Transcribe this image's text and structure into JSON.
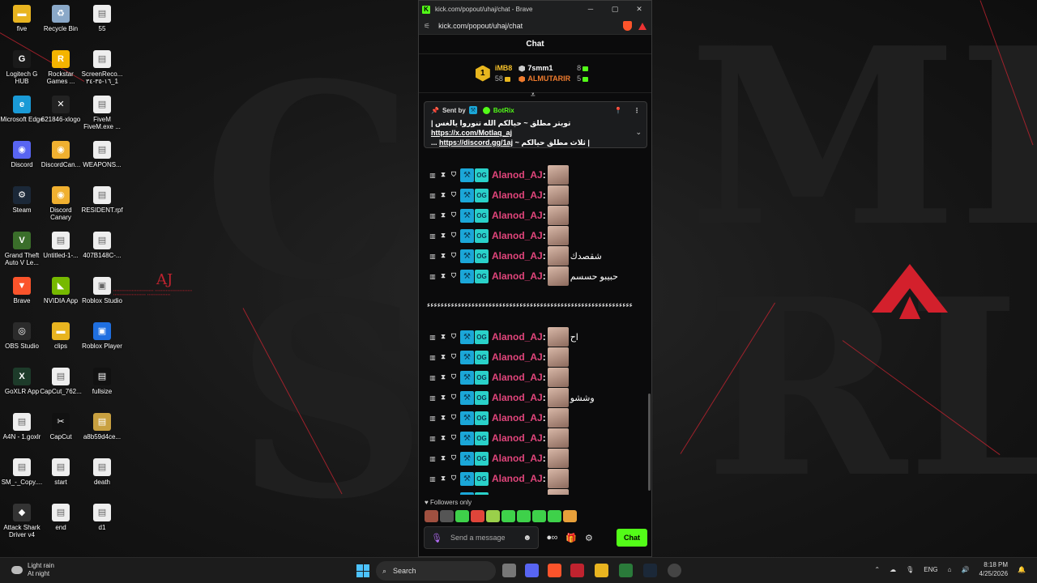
{
  "browser": {
    "window_title": "kick.com/popout/uhaj/chat - Brave",
    "url": "kick.com/popout/uhaj/chat",
    "controls": {
      "minimize": "─",
      "maximize": "▢",
      "close": "✕"
    }
  },
  "chat": {
    "header": "Chat",
    "leaderboard": {
      "rank": "1",
      "top_name": "iMB8",
      "top_count": "58",
      "entries": [
        {
          "name": "7smm1",
          "count": "8"
        },
        {
          "name": "ALMUTARIR",
          "count": "5"
        }
      ]
    },
    "pinned": {
      "sent_by_label": "Sent by",
      "sender": "BotRix",
      "line1": "تويتر مطلق ~ حيالكم الله تنوروا يالغس |",
      "link1": "https://x.com/Motlaq_aj",
      "line2_prefix": "| ثلاث مطلق حيالكم ~",
      "link2": "https://discord.gg/1aj",
      "ellipsis": "..."
    },
    "messages": [
      {
        "user": "Alanod_AJ",
        "text": ""
      },
      {
        "user": "Alanod_AJ",
        "text": ""
      },
      {
        "user": "Alanod_AJ",
        "text": ""
      },
      {
        "user": "Alanod_AJ",
        "text": ""
      },
      {
        "user": "Alanod_AJ",
        "text": "شقصدك"
      },
      {
        "user": "Alanod_AJ",
        "text": "حبيبو حسسم"
      },
      {
        "user": "Alanod_AJ",
        "text": "اح"
      },
      {
        "user": "Alanod_AJ",
        "text": ""
      },
      {
        "user": "Alanod_AJ",
        "text": ""
      },
      {
        "user": "Alanod_AJ",
        "text": "وششو"
      },
      {
        "user": "Alanod_AJ",
        "text": ""
      },
      {
        "user": "Alanod_AJ",
        "text": ""
      },
      {
        "user": "Alanod_AJ",
        "text": ""
      },
      {
        "user": "Alanod_AJ",
        "text": ""
      },
      {
        "user": "Alanod_AJ",
        "text": ""
      }
    ],
    "long_message": "ءءءءءءءءءءءءءءءءءءءءءءءءءءءءءءءءءءءءءءءءءءءءءءءءءءءءءءءءءءءء",
    "followers_only": "Followers only",
    "input_placeholder": "Send a message",
    "send_label": "Chat"
  },
  "desktop": {
    "icons": [
      {
        "label": "five",
        "color": "#e8b420",
        "glyph": "▬"
      },
      {
        "label": "Logitech G HUB",
        "color": "#1a1a1a",
        "glyph": "G"
      },
      {
        "label": "Microsoft Edge",
        "color": "#1a9ad6",
        "glyph": "e"
      },
      {
        "label": "Discord",
        "color": "#5865f2",
        "glyph": "◉"
      },
      {
        "label": "Steam",
        "color": "#1b2838",
        "glyph": "⚙"
      },
      {
        "label": "Grand Theft Auto V Le...",
        "color": "#3a6e2a",
        "glyph": "V"
      },
      {
        "label": "Brave",
        "color": "#fb542b",
        "glyph": "▼"
      },
      {
        "label": "OBS Studio",
        "color": "#2b2b2b",
        "glyph": "◎"
      },
      {
        "label": "GoXLR App",
        "color": "#1d3b2a",
        "glyph": "X"
      },
      {
        "label": "A4N - 1.goxlr",
        "color": "#eeeeee",
        "glyph": "▤"
      },
      {
        "label": "SM_-_Copy....",
        "color": "#eeeeee",
        "glyph": "▤"
      },
      {
        "label": "Attack Shark Driver v4",
        "color": "#333333",
        "glyph": "◆"
      },
      {
        "label": "Recycle Bin",
        "color": "#8aa8c8",
        "glyph": "♻"
      },
      {
        "label": "Rockstar Games ...",
        "color": "#f4b400",
        "glyph": "R"
      },
      {
        "label": "621846-xlogo",
        "color": "#222222",
        "glyph": "✕"
      },
      {
        "label": "DiscordCan...",
        "color": "#f0b030",
        "glyph": "◉"
      },
      {
        "label": "Discord Canary",
        "color": "#f0b030",
        "glyph": "◉"
      },
      {
        "label": "Untitled-1-...",
        "color": "#eeeeee",
        "glyph": "▤"
      },
      {
        "label": "NVIDIA App",
        "color": "#76b900",
        "glyph": "◣"
      },
      {
        "label": "clips",
        "color": "#e8b420",
        "glyph": "▬"
      },
      {
        "label": "CapCut_762...",
        "color": "#eeeeee",
        "glyph": "▤"
      },
      {
        "label": "CapCut",
        "color": "#111111",
        "glyph": "✂"
      },
      {
        "label": "start",
        "color": "#eeeeee",
        "glyph": "▤"
      },
      {
        "label": "end",
        "color": "#eeeeee",
        "glyph": "▤"
      },
      {
        "label": "55",
        "color": "#eeeeee",
        "glyph": "▤"
      },
      {
        "label": "ScreenReco... ١٦-٣٥-٣٤_1",
        "color": "#eeeeee",
        "glyph": "▤"
      },
      {
        "label": "FiveM FiveM.exe ...",
        "color": "#eeeeee",
        "glyph": "▤"
      },
      {
        "label": "WEAPONS...",
        "color": "#eeeeee",
        "glyph": "▤"
      },
      {
        "label": "RESIDENT.rpf",
        "color": "#eeeeee",
        "glyph": "▤"
      },
      {
        "label": "407B148C-...",
        "color": "#eeeeee",
        "glyph": "▤"
      },
      {
        "label": "Roblox Studio",
        "color": "#eeeeee",
        "glyph": "▣"
      },
      {
        "label": "Roblox Player",
        "color": "#1f6fe0",
        "glyph": "▣"
      },
      {
        "label": "fullsize",
        "color": "#111111",
        "glyph": "▤"
      },
      {
        "label": "a8b59d4ce...",
        "color": "#c8a040",
        "glyph": "▤"
      },
      {
        "label": "death",
        "color": "#eeeeee",
        "glyph": "▤"
      },
      {
        "label": "d1",
        "color": "#eeeeee",
        "glyph": "▤"
      }
    ]
  },
  "taskbar": {
    "weather_main": "Light rain",
    "weather_sub": "At night",
    "search_label": "Search",
    "language": "ENG",
    "time": "8:18 PM",
    "date": "4/25/2026"
  }
}
